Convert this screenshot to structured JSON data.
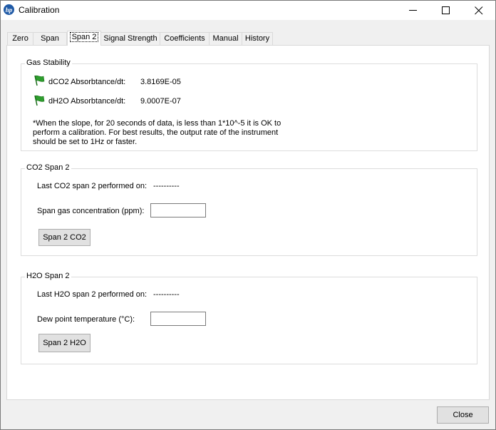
{
  "window": {
    "title": "Calibration",
    "app_icon": "hp-logo-icon",
    "controls": [
      "minimize-icon",
      "maximize-icon",
      "close-icon"
    ]
  },
  "tabs": [
    {
      "label": "Zero",
      "active": false
    },
    {
      "label": "Span",
      "active": false
    },
    {
      "label": "Span 2",
      "active": true
    },
    {
      "label": "Signal Strength",
      "active": false
    },
    {
      "label": "Coefficients",
      "active": false
    },
    {
      "label": "Manual",
      "active": false
    },
    {
      "label": "History",
      "active": false
    }
  ],
  "gas_stability": {
    "title": "Gas Stability",
    "rows": [
      {
        "label": "dCO2 Absorbtance/dt:",
        "value": "3.8169E-05",
        "icon": "green-flag-icon"
      },
      {
        "label": "dH2O Absorbtance/dt:",
        "value": "9.0007E-07",
        "icon": "green-flag-icon"
      }
    ],
    "note_lines": [
      "*When the slope, for 20 seconds of data, is less than 1*10^-5 it is OK to",
      "perform a calibration.  For best results, the output rate of the instrument",
      "should be set to 1Hz or faster."
    ]
  },
  "co2_span2": {
    "title": "CO2 Span 2",
    "last_label": "Last CO2 span 2 performed on:",
    "last_value": "----------",
    "conc_label": "Span gas concentration (ppm):",
    "conc_value": "",
    "button": "Span 2 CO2"
  },
  "h2o_span2": {
    "title": "H2O Span 2",
    "last_label": "Last H2O span 2 performed on:",
    "last_value": "----------",
    "dew_label": "Dew point temperature (°C):",
    "dew_value": "",
    "button": "Span 2 H2O"
  },
  "footer": {
    "close_button": "Close"
  },
  "colors": {
    "flag_green": "#2e9e2e",
    "hp_blue": "#1f5aa6",
    "button_face": "#e1e1e1"
  }
}
